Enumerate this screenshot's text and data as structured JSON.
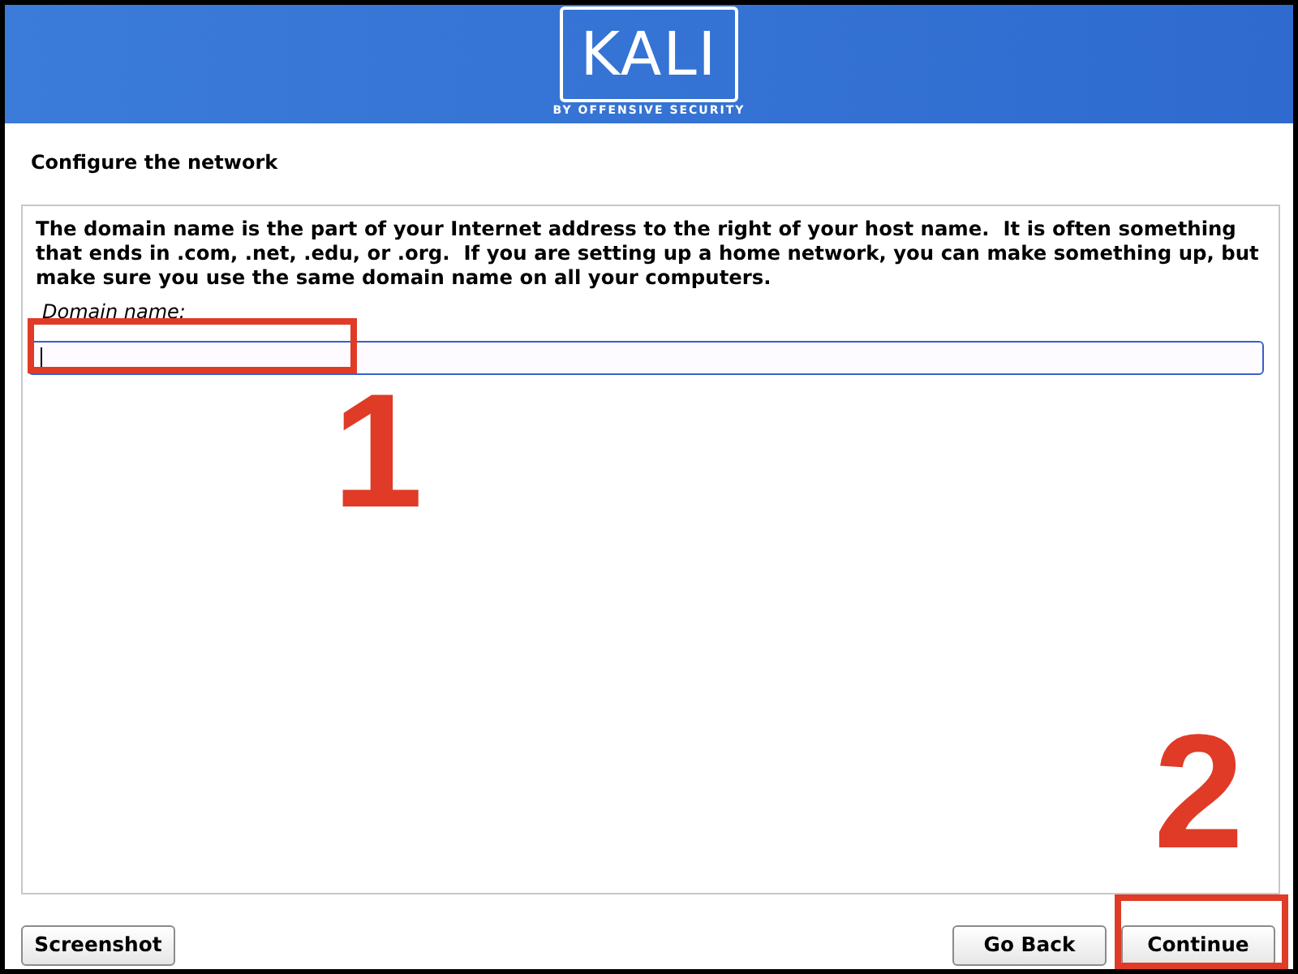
{
  "header": {
    "logo": "KALI",
    "tagline": "BY OFFENSIVE SECURITY"
  },
  "page_title": "Configure the network",
  "description": "The domain name is the part of your Internet address to the right of your host name.  It is often something that ends in .com, .net, .edu, or .org.  If you are setting up a home network, you can make something up, but make sure you use the same domain name on all your computers.",
  "domain_field": {
    "label": "Domain name:",
    "focused": true
  },
  "footer": {
    "left_buttons": [
      {
        "label": "Screenshot"
      }
    ],
    "right_buttons": [
      {
        "label": "Go Back"
      },
      {
        "label": "Continue"
      }
    ]
  },
  "annotations": [
    {
      "number": "1"
    },
    {
      "number": "2"
    }
  ]
}
